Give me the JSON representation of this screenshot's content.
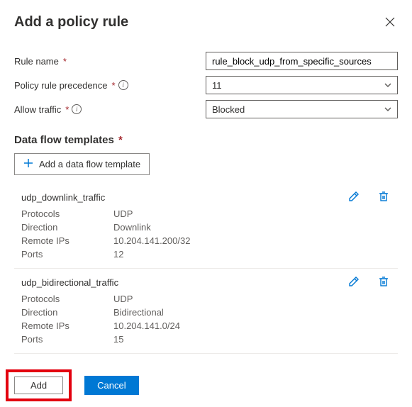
{
  "header": {
    "title": "Add a policy rule"
  },
  "form": {
    "ruleName": {
      "label": "Rule name",
      "value": "rule_block_udp_from_specific_sources"
    },
    "precedence": {
      "label": "Policy rule precedence",
      "value": "11"
    },
    "allowTraffic": {
      "label": "Allow traffic",
      "value": "Blocked"
    }
  },
  "templates": {
    "sectionTitle": "Data flow templates",
    "addLabel": "Add a data flow template",
    "fieldLabels": {
      "protocols": "Protocols",
      "direction": "Direction",
      "remoteIps": "Remote IPs",
      "ports": "Ports"
    },
    "items": [
      {
        "name": "udp_downlink_traffic",
        "protocols": "UDP",
        "direction": "Downlink",
        "remoteIps": "10.204.141.200/32",
        "ports": "12"
      },
      {
        "name": "udp_bidirectional_traffic",
        "protocols": "UDP",
        "direction": "Bidirectional",
        "remoteIps": "10.204.141.0/24",
        "ports": "15"
      }
    ]
  },
  "footer": {
    "add": "Add",
    "cancel": "Cancel"
  }
}
